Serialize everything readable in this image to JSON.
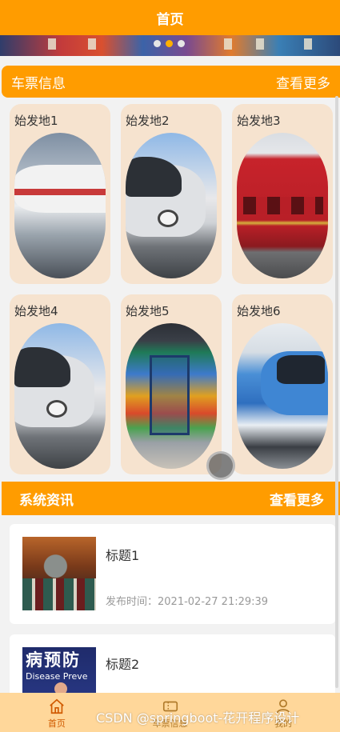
{
  "topbar": {
    "title": "首页"
  },
  "banner": {
    "slides": 3,
    "active_index": 1
  },
  "tickets_section": {
    "title": "车票信息",
    "more": "查看更多",
    "items": [
      {
        "name": "始发地1",
        "image": "silver-streamlined-train"
      },
      {
        "name": "始发地2",
        "image": "silver-high-speed-train"
      },
      {
        "name": "始发地3",
        "image": "red-passenger-train"
      },
      {
        "name": "始发地4",
        "image": "silver-high-speed-train"
      },
      {
        "name": "始发地5",
        "image": "colorful-metro-train"
      },
      {
        "name": "始发地6",
        "image": "blue-white-train"
      }
    ]
  },
  "news_section": {
    "title": "系统资讯",
    "more": "查看更多",
    "items": [
      {
        "title": "标题1",
        "time": "发布时间：2021-02-27 21:29:39"
      },
      {
        "title": "标题2",
        "thumb_text": "病预防",
        "thumb_subtext": "Disease Preve"
      }
    ]
  },
  "tabbar": {
    "tabs": [
      {
        "label": "首页",
        "icon": "home-icon",
        "active": true
      },
      {
        "label": "车票信息",
        "icon": "ticket-icon",
        "active": false
      },
      {
        "label": "我的",
        "icon": "user-icon",
        "active": false
      }
    ]
  },
  "watermark": "CSDN @springboot-花开程序设计",
  "colors": {
    "accent": "#ff9c00",
    "card_bg": "#f6e3cf",
    "tabbar_bg": "#ffd79a"
  }
}
